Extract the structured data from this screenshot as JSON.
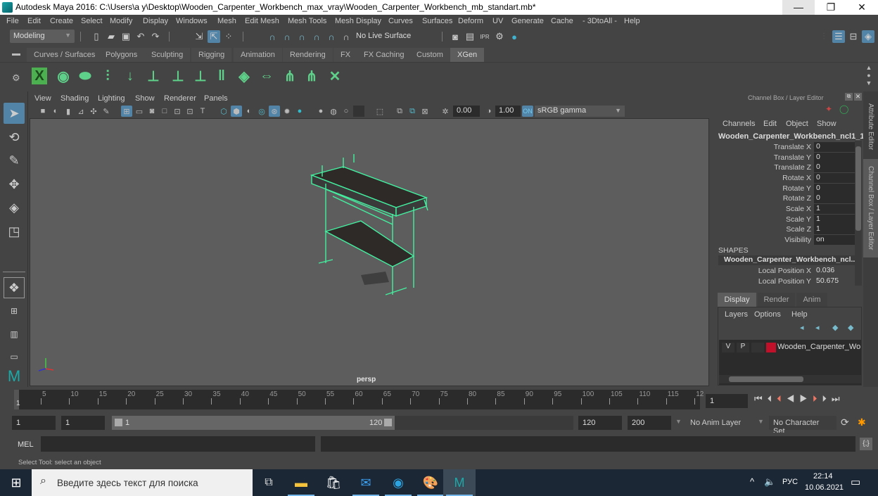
{
  "window": {
    "title": "Autodesk Maya 2016: C:\\Users\\a y\\Desktop\\Wooden_Carpenter_Workbench_max_vray\\Wooden_Carpenter_Workbench_mb_standart.mb*",
    "minimize": "—",
    "maximize": "❐",
    "close": "✕"
  },
  "menu": [
    "File",
    "Edit",
    "Create",
    "Select",
    "Modify",
    "Display",
    "Windows",
    "Mesh",
    "Edit Mesh",
    "Mesh Tools",
    "Mesh Display",
    "Curves",
    "Surfaces",
    "Deform",
    "UV",
    "Generate",
    "Cache",
    "- 3DtoAll -",
    "Help"
  ],
  "statusline": {
    "mode": "Modeling",
    "live_surface": "No Live Surface"
  },
  "shelf": {
    "tabs": [
      "Curves / Surfaces",
      "Polygons",
      "Sculpting",
      "Rigging",
      "Animation",
      "Rendering",
      "FX",
      "FX Caching",
      "Custom",
      "XGen"
    ],
    "active_tab": "XGen",
    "icons": [
      "xgen-editor-icon",
      "preview-eye-icon",
      "clear-preview-icon",
      "add-primitives-icon",
      "import-icon",
      "create-description-icon",
      "guide-view-icon",
      "lock-guides-icon",
      "groom-icon",
      "patch-icon",
      "bind-icon",
      "sculpt-select-icon",
      "sculpt-icon",
      "delete-icon"
    ]
  },
  "viewport": {
    "menu": [
      "View",
      "Shading",
      "Lighting",
      "Show",
      "Renderer",
      "Panels"
    ],
    "exposure": "0.00",
    "gamma": "1.00",
    "color_space": "sRGB gamma",
    "camera_label": "persp",
    "model_color": "#44f0a0"
  },
  "channel_box": {
    "title": "Channel Box / Layer Editor",
    "menu": [
      "Channels",
      "Edit",
      "Object",
      "Show"
    ],
    "object_name": "Wooden_Carpenter_Workbench_ncl1_1",
    "channels": [
      {
        "label": "Translate X",
        "value": "0"
      },
      {
        "label": "Translate Y",
        "value": "0"
      },
      {
        "label": "Translate Z",
        "value": "0"
      },
      {
        "label": "Rotate X",
        "value": "0"
      },
      {
        "label": "Rotate Y",
        "value": "0"
      },
      {
        "label": "Rotate Z",
        "value": "0"
      },
      {
        "label": "Scale X",
        "value": "1"
      },
      {
        "label": "Scale Y",
        "value": "1"
      },
      {
        "label": "Scale Z",
        "value": "1"
      },
      {
        "label": "Visibility",
        "value": "on"
      }
    ],
    "shapes_header": "SHAPES",
    "shape_name": "Wooden_Carpenter_Workbench_ncl...",
    "shape_channels": [
      {
        "label": "Local Position X",
        "value": "0.036"
      },
      {
        "label": "Local Position Y",
        "value": "50.675"
      }
    ]
  },
  "side_tabs": {
    "attribute_editor": "Attribute Editor",
    "channel_box": "Channel Box / Layer Editor"
  },
  "layer_editor": {
    "tabs": [
      "Display",
      "Render",
      "Anim"
    ],
    "active_tab": "Display",
    "menu": [
      "Layers",
      "Options",
      "Help"
    ],
    "layer": {
      "v": "V",
      "p": "P",
      "name": "Wooden_Carpenter_Wo",
      "color": "#c0102a"
    }
  },
  "timeline": {
    "ticks": [
      "5",
      "10",
      "15",
      "20",
      "25",
      "30",
      "35",
      "40",
      "45",
      "50",
      "55",
      "60",
      "65",
      "70",
      "75",
      "80",
      "85",
      "90",
      "95",
      "100",
      "105",
      "110",
      "115",
      "12"
    ],
    "current_marker": "1",
    "current_frame": "1",
    "range_start": "1",
    "playback_start": "1",
    "range_bar_start": "1",
    "range_bar_end": "120",
    "playback_end": "120",
    "range_end": "200",
    "anim_layer": "No Anim Layer",
    "character_set": "No Character Set"
  },
  "command_line": {
    "label": "MEL",
    "value": ""
  },
  "help_line": "Select Tool: select an object",
  "taskbar": {
    "search_placeholder": "Введите здесь текст для поиска",
    "language": "РУС",
    "time": "22:14",
    "date": "10.06.2021"
  }
}
